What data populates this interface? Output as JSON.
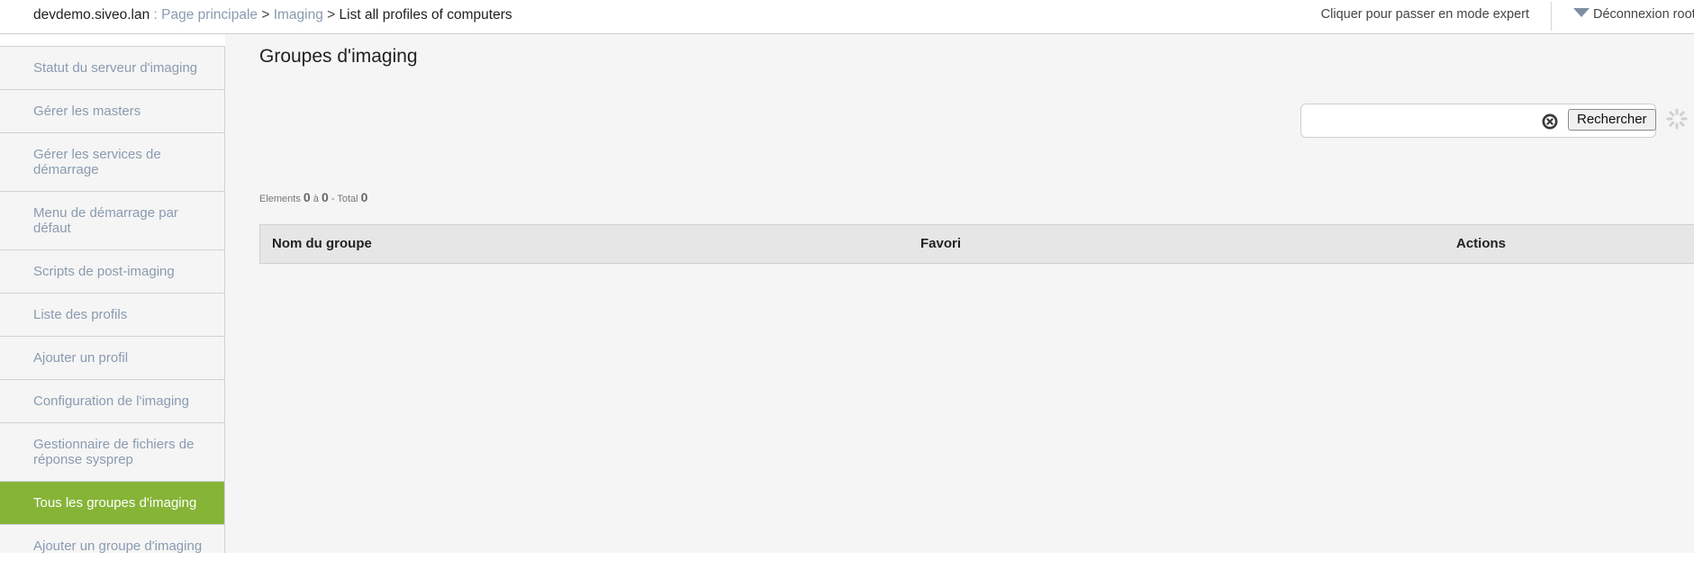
{
  "header": {
    "host": "devdemo.siveo.lan",
    "host_sep": " : ",
    "breadcrumb": {
      "home": "Page principale",
      "sep1": " > ",
      "module": "Imaging",
      "sep2": " > ",
      "current": "List all profiles of computers"
    },
    "expert_mode": "Cliquer pour passer en mode expert",
    "logout": "Déconnexion root"
  },
  "sidebar": {
    "items": [
      {
        "label": "Statut du serveur d'imaging",
        "active": false
      },
      {
        "label": "Gérer les masters",
        "active": false
      },
      {
        "label": "Gérer les services de démarrage",
        "active": false
      },
      {
        "label": "Menu de démarrage par défaut",
        "active": false
      },
      {
        "label": "Scripts de post-imaging",
        "active": false
      },
      {
        "label": "Liste des profils",
        "active": false
      },
      {
        "label": "Ajouter un profil",
        "active": false
      },
      {
        "label": "Configuration de l'imaging",
        "active": false
      },
      {
        "label": "Gestionnaire de fichiers de réponse sysprep",
        "active": false
      },
      {
        "label": "Tous les groupes d'imaging",
        "active": true
      },
      {
        "label": "Ajouter un groupe d'imaging",
        "active": false
      }
    ]
  },
  "main": {
    "title": "Groupes d'imaging",
    "search": {
      "value": "",
      "placeholder": "",
      "button_label": "Rechercher"
    },
    "counter": {
      "elements_label": "Elements",
      "from": "0",
      "to_label": "à",
      "to": "0",
      "total_label": "- Total",
      "total": "0"
    },
    "table": {
      "columns": [
        "Nom du groupe",
        "Favori",
        "Actions"
      ],
      "rows": []
    }
  },
  "colors": {
    "accent": "#86b437",
    "link": "#8a9bb0",
    "background": "#f5f5f5"
  },
  "icons": {
    "clear": "clear-circle-x-icon",
    "loading": "spinner-gear-icon",
    "logout_arrow": "triangle-down-icon"
  }
}
